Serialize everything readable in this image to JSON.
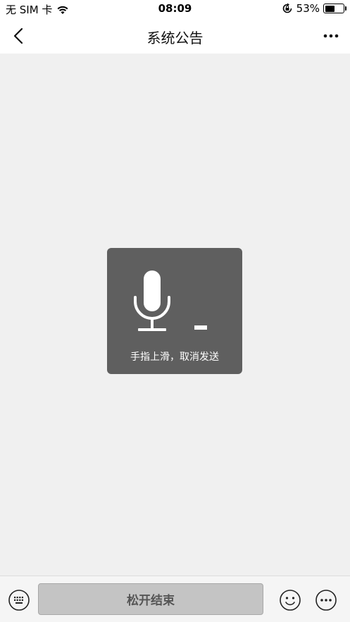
{
  "status_bar": {
    "carrier": "无 SIM 卡",
    "time": "08:09",
    "battery_percent": "53%",
    "battery_level": 0.53,
    "icons": [
      "wifi-icon",
      "rotation-lock-icon",
      "battery-icon"
    ]
  },
  "nav": {
    "title": "系统公告",
    "back_icon": "chevron-left-icon",
    "more_icon": "more-horizontal-icon"
  },
  "voice_hud": {
    "hint": "手指上滑，取消发送",
    "icon": "microphone-icon"
  },
  "input_bar": {
    "keyboard_icon": "keyboard-icon",
    "hold_button_label": "松开结束",
    "emoji_icon": "emoji-icon",
    "more_icon": "more-circle-icon"
  },
  "colors": {
    "hud_background": "#5f5f5f",
    "page_background": "#f0f0f0",
    "hold_button_background": "#c4c4c4"
  }
}
